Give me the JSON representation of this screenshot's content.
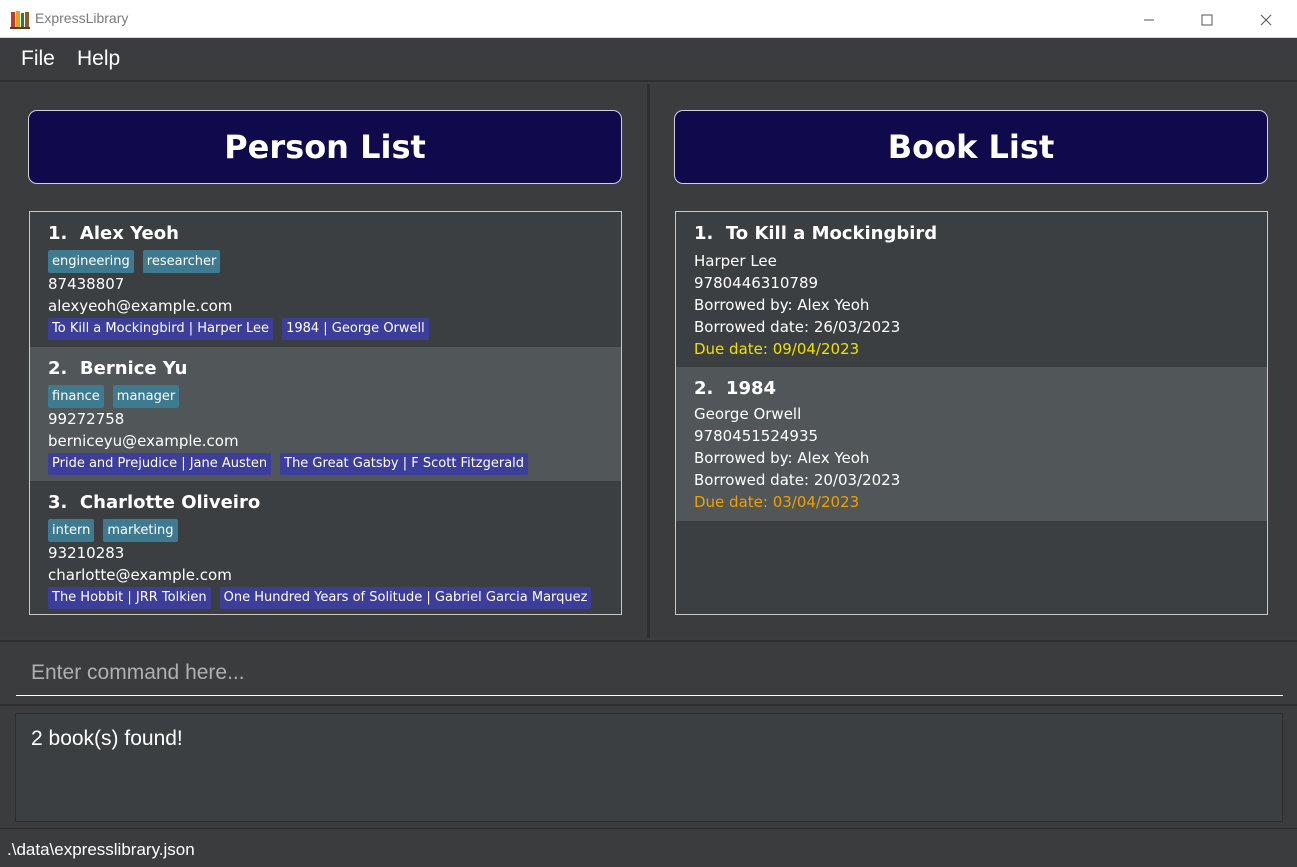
{
  "window": {
    "title": "ExpressLibrary",
    "minimize_icon": "minimize-icon",
    "maximize_icon": "maximize-icon",
    "close_icon": "close-icon"
  },
  "menu": [
    {
      "label": "File"
    },
    {
      "label": "Help"
    }
  ],
  "person_panel": {
    "header": "Person List",
    "persons": [
      {
        "index": "1.",
        "name": "Alex Yeoh",
        "tags": [
          "engineering",
          "researcher"
        ],
        "phone": "87438807",
        "email": "alexyeoh@example.com",
        "books": [
          "To Kill a Mockingbird | Harper Lee",
          "1984 | George Orwell"
        ]
      },
      {
        "index": "2.",
        "name": "Bernice Yu",
        "tags": [
          "finance",
          "manager"
        ],
        "phone": "99272758",
        "email": "berniceyu@example.com",
        "books": [
          "Pride and Prejudice | Jane Austen",
          "The Great Gatsby | F Scott Fitzgerald"
        ]
      },
      {
        "index": "3.",
        "name": "Charlotte Oliveiro",
        "tags": [
          "intern",
          "marketing"
        ],
        "phone": "93210283",
        "email": "charlotte@example.com",
        "books": [
          "The Hobbit | JRR Tolkien",
          "One Hundred Years of Solitude | Gabriel Garcia Marquez"
        ]
      }
    ]
  },
  "book_panel": {
    "header": "Book List",
    "books": [
      {
        "index": "1.",
        "title": "To Kill a Mockingbird",
        "author": "Harper Lee",
        "isbn": "9780446310789",
        "borrowed_by": "Borrowed by: Alex Yeoh",
        "borrowed_date": "Borrowed date: 26/03/2023",
        "due_date": "Due date: 09/04/2023",
        "due_color": "#f0e000"
      },
      {
        "index": "2.",
        "title": "1984",
        "author": "George Orwell",
        "isbn": "9780451524935",
        "borrowed_by": "Borrowed by: Alex Yeoh",
        "borrowed_date": "Borrowed date: 20/03/2023",
        "due_date": "Due date: 03/04/2023",
        "due_color": "#f0a000"
      }
    ]
  },
  "command": {
    "placeholder": "Enter command here...",
    "value": ""
  },
  "result": {
    "text": "2 book(s) found!"
  },
  "status": {
    "path": ".\\data\\expresslibrary.json"
  },
  "colors": {
    "header_bg": "#100a4c",
    "tag_bg": "#3e7b91",
    "book_tag_bg": "#3d3d9a",
    "alt_row_bg": "#515658",
    "background": "#3c3f41"
  }
}
